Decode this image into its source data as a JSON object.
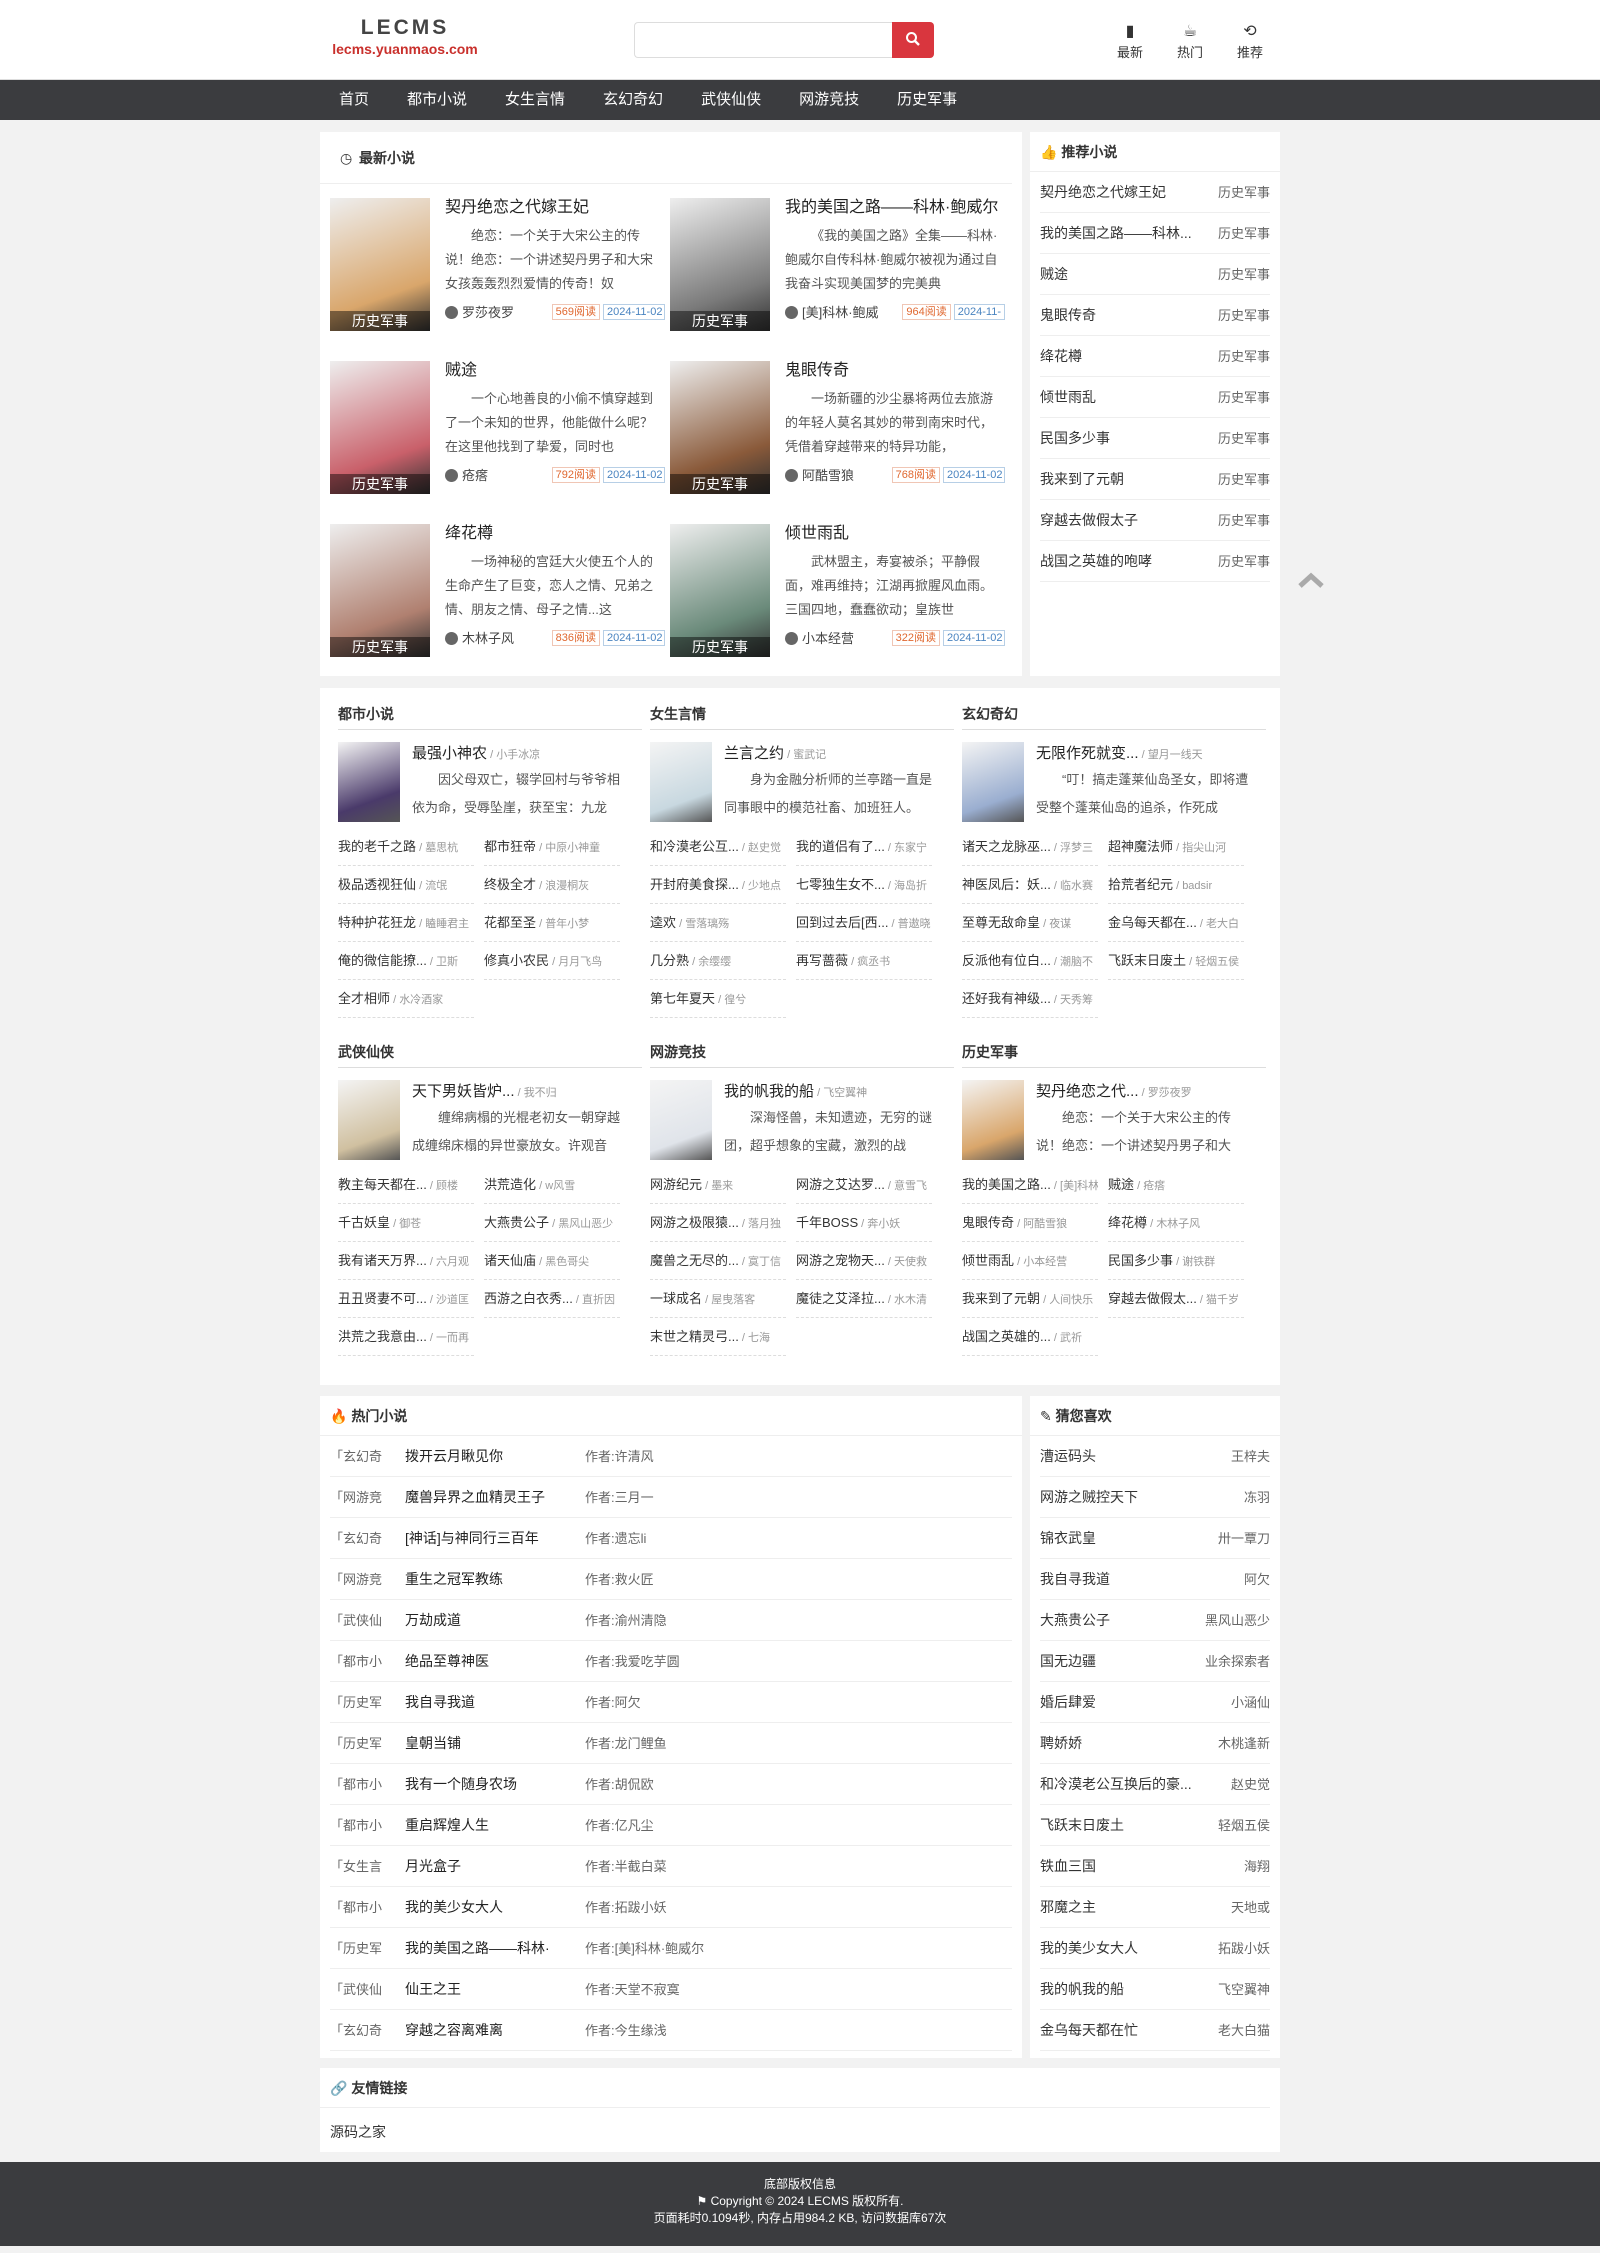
{
  "header": {
    "logo_name": "LECMS",
    "logo_domain": "lecms.yuanmaos.com",
    "search_placeholder": "",
    "tools": [
      {
        "icon": "book-icon",
        "label": "最新"
      },
      {
        "icon": "cup-icon",
        "label": "热门"
      },
      {
        "icon": "history-icon",
        "label": "推荐"
      }
    ]
  },
  "nav": [
    "首页",
    "都市小说",
    "女生言情",
    "玄幻奇幻",
    "武侠仙侠",
    "网游竞技",
    "历史军事"
  ],
  "latest": {
    "title": "最新小说",
    "books": [
      {
        "title": "契丹绝恋之代嫁王妃",
        "desc": "绝恋：一个关于大宋公主的传说！绝恋：一个讲述契丹男子和大宋女孩轰轰烈烈爱情的传奇！奴",
        "author": "罗莎夜罗",
        "reads": "569阅读",
        "date": "2024-11-02",
        "tag": "历史军事",
        "color": "#d9a66b"
      },
      {
        "title": "我的美国之路——科林·鲍威尔",
        "desc": "《我的美国之路》全集——科林·鲍威尔自传科林·鲍威尔被视为通过自我奋斗实现美国梦的完美典",
        "author": "[美]科林·鲍威",
        "reads": "964阅读",
        "date": "2024-11-",
        "tag": "历史军事",
        "color": "#7a7a7a"
      },
      {
        "title": "贼途",
        "desc": "一个心地善良的小偷不慎穿越到了一个未知的世界，他能做什么呢？在这里他找到了挚爱，同时也",
        "author": "疮瘩",
        "reads": "792阅读",
        "date": "2024-11-02",
        "tag": "历史军事",
        "color": "#c9606a"
      },
      {
        "title": "鬼眼传奇",
        "desc": "一场新疆的沙尘暴将两位去旅游的年轻人莫名其妙的带到南宋时代，凭借着穿越带来的特异功能，",
        "author": "阿酷雪狼",
        "reads": "768阅读",
        "date": "2024-11-02",
        "tag": "历史军事",
        "color": "#8a5a3a"
      },
      {
        "title": "绛花樽",
        "desc": "一场神秘的宫廷大火使五个人的生命产生了巨变，恋人之情、兄弟之情、朋友之情、母子之情...这",
        "author": "木林子风",
        "reads": "836阅读",
        "date": "2024-11-02",
        "tag": "历史军事",
        "color": "#b08070"
      },
      {
        "title": "倾世雨乱",
        "desc": "武林盟主，寿宴被杀；平静假面，难再维持；江湖再掀腥风血雨。三国四地，蠢蠢欲动；皇族世",
        "author": "小本经营",
        "reads": "322阅读",
        "date": "2024-11-02",
        "tag": "历史军事",
        "color": "#6a8a7a"
      }
    ]
  },
  "recommend": {
    "title": "推荐小说",
    "items": [
      {
        "name": "契丹绝恋之代嫁王妃",
        "cat": "历史军事"
      },
      {
        "name": "我的美国之路——科林...",
        "cat": "历史军事"
      },
      {
        "name": "贼途",
        "cat": "历史军事"
      },
      {
        "name": "鬼眼传奇",
        "cat": "历史军事"
      },
      {
        "name": "绛花樽",
        "cat": "历史军事"
      },
      {
        "name": "倾世雨乱",
        "cat": "历史军事"
      },
      {
        "name": "民国多少事",
        "cat": "历史军事"
      },
      {
        "name": "我来到了元朝",
        "cat": "历史军事"
      },
      {
        "name": "穿越去做假太子",
        "cat": "历史军事"
      },
      {
        "name": "战国之英雄的咆哮",
        "cat": "历史军事"
      }
    ]
  },
  "categories": [
    {
      "name": "都市小说",
      "feat": {
        "title": "最强小神农",
        "author": "小手冰凉",
        "desc": "因父母双亡，辍学回村与爷爷相依为命，受辱坠崖，获至宝：九龙",
        "color": "#4a3a6a"
      },
      "links": [
        [
          "我的老千之路",
          "墓思杭"
        ],
        [
          "都市狂帝",
          "中原小神童"
        ],
        [
          "极品透视狂仙",
          "流氓"
        ],
        [
          "终极全才",
          "浪漫桐灰"
        ],
        [
          "特种护花狂龙",
          "瞌睡君主"
        ],
        [
          "花都至圣",
          "普年小梦"
        ],
        [
          "俺的微信能撩...",
          "卫斯"
        ],
        [
          "修真小农民",
          "月月飞鸟"
        ],
        [
          "全才相师",
          "水冷酒家"
        ]
      ]
    },
    {
      "name": "女生言情",
      "feat": {
        "title": "兰言之约",
        "author": "蜜武记",
        "desc": "身为金融分析师的兰亭踏一直是同事眼中的模范社畜、加班狂人。",
        "color": "#c8d8e0"
      },
      "links": [
        [
          "和冷漠老公互...",
          "赵史觉"
        ],
        [
          "我的道侣有了...",
          "东家宁"
        ],
        [
          "开封府美食探...",
          "少地点"
        ],
        [
          "七零独生女不...",
          "海岛折"
        ],
        [
          "逵欢",
          "雪落璃殇"
        ],
        [
          "回到过去后[西...",
          "普遨晓"
        ],
        [
          "几分熟",
          "余缨缨"
        ],
        [
          "再写蔷薇",
          "疯丞书"
        ],
        [
          "第七年夏天",
          "徨兮"
        ]
      ]
    },
    {
      "name": "玄幻奇幻",
      "feat": {
        "title": "无限作死就变...",
        "author": "望月一线天",
        "desc": "“叮！搞走蓬莱仙岛圣女，即将遭受整个蓬莱仙岛的追杀，作死成",
        "color": "#9aaed0"
      },
      "links": [
        [
          "诸天之龙脉巫...",
          "浮梦三"
        ],
        [
          "超神魔法师",
          "指尖山河"
        ],
        [
          "神医凤后：妖...",
          "临水赛"
        ],
        [
          "拾荒者纪元",
          "badsir"
        ],
        [
          "至尊无敌命皇",
          "夜谋"
        ],
        [
          "金乌每天都在...",
          "老大白"
        ],
        [
          "反派他有位白...",
          "潮脑不"
        ],
        [
          "飞跃末日废土",
          "轻烟五侯"
        ],
        [
          "还好我有神级...",
          "天秀筹"
        ]
      ]
    },
    {
      "name": "武侠仙侠",
      "feat": {
        "title": "天下男妖皆炉...",
        "author": "我不归",
        "desc": "缠绵病榻的光棍老初女一朝穿越成缠绵床榻的异世豪放女。许观音",
        "color": "#d0c0a0"
      },
      "links": [
        [
          "教主每天都在...",
          "顾楼"
        ],
        [
          "洪荒造化",
          "w风雪"
        ],
        [
          "千古妖皇",
          "御苍"
        ],
        [
          "大燕贵公子",
          "黑风山恶少"
        ],
        [
          "我有诸天万界...",
          "六月观"
        ],
        [
          "诸天仙庙",
          "黑色哥尖"
        ],
        [
          "丑丑贤妻不可...",
          "沙道匡"
        ],
        [
          "西游之白衣秀...",
          "直折因"
        ],
        [
          "洪荒之我意由...",
          "一而再"
        ]
      ]
    },
    {
      "name": "网游竞技",
      "feat": {
        "title": "我的帆我的船",
        "author": "飞空翼神",
        "desc": "深海怪兽，未知遗迹，无穷的谜团，超乎想象的宝藏，激烈的战",
        "color": "#e0e4ea"
      },
      "links": [
        [
          "网游纪元",
          "墨来"
        ],
        [
          "网游之艾达罗...",
          "意雪飞"
        ],
        [
          "网游之极限猿...",
          "落月独"
        ],
        [
          "千年BOSS",
          "奔小妖"
        ],
        [
          "魔兽之无尽的...",
          "寞丁信"
        ],
        [
          "网游之宠物天...",
          "天使救"
        ],
        [
          "一球成名",
          "屋曳落客"
        ],
        [
          "魔徒之艾泽拉...",
          "水木清"
        ],
        [
          "末世之精灵弓...",
          "七海"
        ]
      ]
    },
    {
      "name": "历史军事",
      "feat": {
        "title": "契丹绝恋之代...",
        "author": "罗莎夜罗",
        "desc": "绝恋：一个关于大宋公主的传说！绝恋：一个讲述契丹男子和大",
        "color": "#d9a66b"
      },
      "links": [
        [
          "我的美国之路...",
          "[美]科林"
        ],
        [
          "贼途",
          "疮瘩"
        ],
        [
          "鬼眼传奇",
          "阿酷雪狼"
        ],
        [
          "绛花樽",
          "木林子风"
        ],
        [
          "倾世雨乱",
          "小本经营"
        ],
        [
          "民国多少事",
          "谢铁群"
        ],
        [
          "我来到了元朝",
          "人间快乐"
        ],
        [
          "穿越去做假太...",
          "猫千岁"
        ],
        [
          "战国之英雄的...",
          "武祈"
        ]
      ]
    }
  ],
  "hot": {
    "title": "热门小说",
    "items": [
      {
        "cat": "「玄幻奇",
        "name": "拨开云月瞅见你",
        "author": "作者:许清风"
      },
      {
        "cat": "「网游竞",
        "name": "魔兽异界之血精灵王子",
        "author": "作者:三月一"
      },
      {
        "cat": "「玄幻奇",
        "name": "[神话]与神同行三百年",
        "author": "作者:遗忘li"
      },
      {
        "cat": "「网游竞",
        "name": "重生之冠军教练",
        "author": "作者:救火匠"
      },
      {
        "cat": "「武侠仙",
        "name": "万劫成道",
        "author": "作者:渝州清隐"
      },
      {
        "cat": "「都市小",
        "name": "绝品至尊神医",
        "author": "作者:我爱吃芋圆"
      },
      {
        "cat": "「历史军",
        "name": "我自寻我道",
        "author": "作者:阿欠"
      },
      {
        "cat": "「历史军",
        "name": "皇朝当铺",
        "author": "作者:龙门鲤鱼"
      },
      {
        "cat": "「都市小",
        "name": "我有一个随身农场",
        "author": "作者:胡侃欧"
      },
      {
        "cat": "「都市小",
        "name": "重启辉煌人生",
        "author": "作者:亿凡尘"
      },
      {
        "cat": "「女生言",
        "name": "月光盒子",
        "author": "作者:半截白菜"
      },
      {
        "cat": "「都市小",
        "name": "我的美少女大人",
        "author": "作者:拓跋小妖"
      },
      {
        "cat": "「历史军",
        "name": "我的美国之路——科林·",
        "author": "作者:[美]科林·鲍威尔"
      },
      {
        "cat": "「武侠仙",
        "name": "仙王之王",
        "author": "作者:天堂不寂寞"
      },
      {
        "cat": "「玄幻奇",
        "name": "穿越之容离难离",
        "author": "作者:今生缘浅"
      }
    ]
  },
  "guess": {
    "title": "猜您喜欢",
    "items": [
      {
        "name": "漕运码头",
        "author": "王梓夫"
      },
      {
        "name": "网游之贼控天下",
        "author": "冻羽"
      },
      {
        "name": "锦衣武皇",
        "author": "卅一覃刀"
      },
      {
        "name": "我自寻我道",
        "author": "阿欠"
      },
      {
        "name": "大燕贵公子",
        "author": "黑风山恶少"
      },
      {
        "name": "国无边疆",
        "author": "业余探索者"
      },
      {
        "name": "婚后肆爱",
        "author": "小涵仙"
      },
      {
        "name": "聘娇娇",
        "author": "木桃逢新"
      },
      {
        "name": "和冷漠老公互换后的豪...",
        "author": "赵史觉"
      },
      {
        "name": "飞跃末日废土",
        "author": "轻烟五侯"
      },
      {
        "name": "铁血三国",
        "author": "海翔"
      },
      {
        "name": "邪魔之主",
        "author": "天地或"
      },
      {
        "name": "我的美少女大人",
        "author": "拓跋小妖"
      },
      {
        "name": "我的帆我的船",
        "author": "飞空翼神"
      },
      {
        "name": "金乌每天都在忙",
        "author": "老大白猫"
      }
    ]
  },
  "links": {
    "title": "友情链接",
    "items": [
      "源码之家"
    ]
  },
  "footer": {
    "line1": "底部版权信息",
    "line2": "Copyright © 2024 LECMS 版权所有.",
    "line3": "页面耗时0.1094秒, 内存占用984.2 KB, 访问数据库67次"
  }
}
